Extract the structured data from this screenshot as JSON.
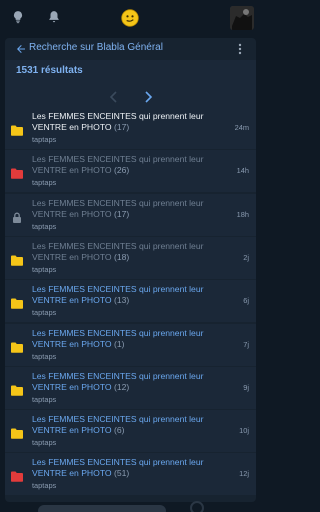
{
  "topbar": {
    "icons": [
      "lightbulb-icon",
      "bell-icon",
      "smiley-icon",
      "avatar"
    ]
  },
  "header": {
    "back_label": "Recherche sur Blabla Général",
    "more_icon": "more-vertical-icon"
  },
  "results": {
    "count_label": "1531 résultats",
    "pager_prev_icon": "chevron-left-icon",
    "pager_next_icon": "chevron-right-icon"
  },
  "colors": {
    "background": "#0f1924",
    "panel": "#172330",
    "row": "#1b2838",
    "accent": "#6aa7ee",
    "folder_yellow": "#f5c518",
    "folder_red": "#e23b3b",
    "lock_gray": "#7d8a99"
  },
  "rows": [
    {
      "icon": "folder-yellow",
      "title": "Les FEMMES ENCEINTES qui prennent leur VENTRE en PHOTO",
      "count": "(17)",
      "author": "taptaps",
      "time": "24m",
      "style": "white"
    },
    {
      "icon": "folder-red",
      "title": "Les FEMMES ENCEINTES qui prennent leur VENTRE en PHOTO",
      "count": "(26)",
      "author": "taptaps",
      "time": "14h",
      "style": "gray"
    },
    {
      "icon": "lock",
      "title": "Les FEMMES ENCEINTES qui prennent leur VENTRE en PHOTO",
      "count": "(17)",
      "author": "taptaps",
      "time": "18h",
      "style": "gray"
    },
    {
      "icon": "folder-yellow",
      "title": "Les FEMMES ENCEINTES qui prennent leur VENTRE en PHOTO",
      "count": "(18)",
      "author": "taptaps",
      "time": "2j",
      "style": "gray"
    },
    {
      "icon": "folder-yellow",
      "title": "Les FEMMES ENCEINTES qui prennent leur VENTRE en PHOTO",
      "count": "(13)",
      "author": "taptaps",
      "time": "6j",
      "style": "blue"
    },
    {
      "icon": "folder-yellow",
      "title": "Les FEMMES ENCEINTES qui prennent leur VENTRE en PHOTO",
      "count": "(1)",
      "author": "taptaps",
      "time": "7j",
      "style": "blue"
    },
    {
      "icon": "folder-yellow",
      "title": "Les FEMMES ENCEINTES qui prennent leur VENTRE en PHOTO",
      "count": "(12)",
      "author": "taptaps",
      "time": "9j",
      "style": "blue"
    },
    {
      "icon": "folder-yellow",
      "title": "Les FEMMES ENCEINTES qui prennent leur VENTRE en PHOTO",
      "count": "(6)",
      "author": "taptaps",
      "time": "10j",
      "style": "blue"
    },
    {
      "icon": "folder-red",
      "title": "Les FEMMES ENCEINTES qui prennent leur VENTRE en PHOTO",
      "count": "(51)",
      "author": "taptaps",
      "time": "12j",
      "style": "blue"
    }
  ]
}
